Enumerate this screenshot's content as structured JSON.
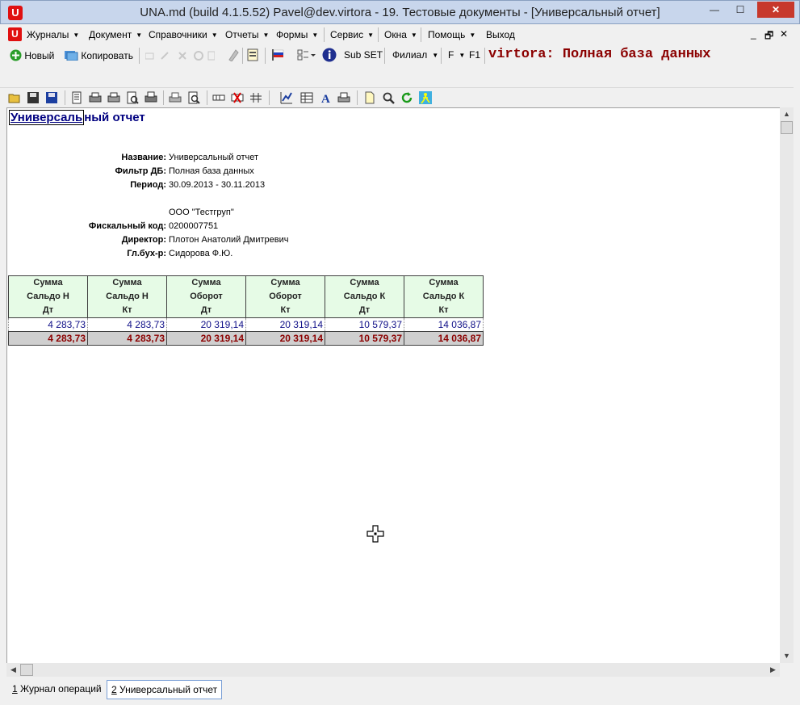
{
  "window": {
    "title": "UNA.md (build 4.1.5.52) Pavel@dev.virtora - 19. Тестовые документы - [Универсальный отчет]",
    "app_icon": "U",
    "minimize_glyph": "—",
    "maximize_glyph": "☐",
    "close_glyph": "✕"
  },
  "menu": {
    "items": [
      "Журналы",
      "Документ",
      "Справочники",
      "Отчеты",
      "Формы",
      "Сервис",
      "Окна",
      "Помощь",
      "Выход"
    ],
    "mdi_controls": [
      "_",
      "🗗",
      "✕"
    ]
  },
  "toolbar1": {
    "new_label": "Новый",
    "copy_label": "Копировать",
    "subset_label": "Sub SET",
    "branch_label": "Филиал",
    "f_label": "F",
    "f1_label": "F1",
    "database_title": "virtora: Полная база данных"
  },
  "report": {
    "title": "Универсальный отчет",
    "title_selected_part": "Универсаль",
    "title_rest": "ный отчет",
    "info": [
      {
        "label": "Название:",
        "value": "Универсальный отчет"
      },
      {
        "label": "Фильтр ДБ:",
        "value": "Полная база данных"
      },
      {
        "label": "Период:",
        "value": "30.09.2013 - 30.11.2013"
      }
    ],
    "company": "ООО \"Тестгруп\"",
    "company_info": [
      {
        "label": "Фискальный код:",
        "value": "0200007751"
      },
      {
        "label": "Директор:",
        "value": "Плотон Анатолий Дмитревич"
      },
      {
        "label": "Гл.бух-р:",
        "value": "Сидорова Ф.Ю."
      }
    ],
    "table": {
      "headers": [
        [
          "Сумма",
          "Сальдо Н",
          "Дт"
        ],
        [
          "Сумма",
          "Сальдо Н",
          "Кт"
        ],
        [
          "Сумма",
          "Оборот",
          "Дт"
        ],
        [
          "Сумма",
          "Оборот",
          "Кт"
        ],
        [
          "Сумма",
          "Сальдо К",
          "Дт"
        ],
        [
          "Сумма",
          "Сальдо К",
          "Кт"
        ]
      ],
      "rows": [
        [
          "4 283,73",
          "4 283,73",
          "20 319,14",
          "20 319,14",
          "10 579,37",
          "14 036,87"
        ]
      ],
      "totals": [
        "4 283,73",
        "4 283,73",
        "20 319,14",
        "20 319,14",
        "10 579,37",
        "14 036,87"
      ]
    }
  },
  "window_tabs": [
    {
      "num": "1",
      "label": " Журнал операций"
    },
    {
      "num": "2",
      "label": " Универсальный отчет"
    }
  ],
  "colors": {
    "accent_red": "#e01010",
    "db_title": "#8b0000",
    "report_title": "#000080",
    "header_bg": "#e6fbe6",
    "total_bg": "#cfcfcf"
  }
}
